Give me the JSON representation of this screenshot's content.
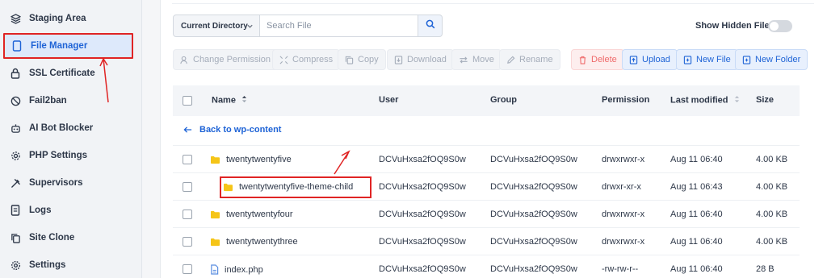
{
  "sidebar": {
    "items": [
      {
        "label": "Staging Area",
        "icon": "layers-icon"
      },
      {
        "label": "File Manager",
        "icon": "file-icon",
        "active": true
      },
      {
        "label": "SSL Certificate",
        "icon": "lock-icon"
      },
      {
        "label": "Fail2ban",
        "icon": "ban-icon"
      },
      {
        "label": "AI Bot Blocker",
        "icon": "robot-icon"
      },
      {
        "label": "PHP Settings",
        "icon": "gear-icon"
      },
      {
        "label": "Supervisors",
        "icon": "tools-icon"
      },
      {
        "label": "Logs",
        "icon": "log-file-icon"
      },
      {
        "label": "Site Clone",
        "icon": "copy-icon"
      },
      {
        "label": "Settings",
        "icon": "settings-icon"
      }
    ]
  },
  "search": {
    "scope": "Current Directory",
    "placeholder": "Search File"
  },
  "hidden_files": {
    "label": "Show Hidden Files",
    "enabled": false
  },
  "toolbar": {
    "change_permission": "Change Permission",
    "compress": "Compress",
    "copy": "Copy",
    "download": "Download",
    "move": "Move",
    "rename": "Rename",
    "delete": "Delete",
    "upload": "Upload",
    "new_file": "New File",
    "new_folder": "New Folder"
  },
  "table": {
    "headers": {
      "name": "Name",
      "user": "User",
      "group": "Group",
      "permission": "Permission",
      "last_modified": "Last modified",
      "size": "Size"
    },
    "back_link": "Back to wp-content",
    "rows": [
      {
        "name": "twentytwentyfive",
        "type": "folder",
        "user": "DCVuHxsa2fOQ9S0w",
        "group": "DCVuHxsa2fOQ9S0w",
        "permission": "drwxrwxr-x",
        "modified": "Aug 11 06:40",
        "size": "4.00 KB"
      },
      {
        "name": "twentytwentyfive-theme-child",
        "type": "folder",
        "user": "DCVuHxsa2fOQ9S0w",
        "group": "DCVuHxsa2fOQ9S0w",
        "permission": "drwxr-xr-x",
        "modified": "Aug 11 06:43",
        "size": "4.00 KB",
        "highlighted": true
      },
      {
        "name": "twentytwentyfour",
        "type": "folder",
        "user": "DCVuHxsa2fOQ9S0w",
        "group": "DCVuHxsa2fOQ9S0w",
        "permission": "drwxrwxr-x",
        "modified": "Aug 11 06:40",
        "size": "4.00 KB"
      },
      {
        "name": "twentytwentythree",
        "type": "folder",
        "user": "DCVuHxsa2fOQ9S0w",
        "group": "DCVuHxsa2fOQ9S0w",
        "permission": "drwxrwxr-x",
        "modified": "Aug 11 06:40",
        "size": "4.00 KB"
      },
      {
        "name": "index.php",
        "type": "file",
        "user": "DCVuHxsa2fOQ9S0w",
        "group": "DCVuHxsa2fOQ9S0w",
        "permission": "-rw-rw-r--",
        "modified": "Aug 11 06:40",
        "size": "28 B"
      }
    ]
  },
  "colors": {
    "accent": "#1e63d6",
    "annotation_red": "#e02424",
    "folder": "#f5c518"
  }
}
